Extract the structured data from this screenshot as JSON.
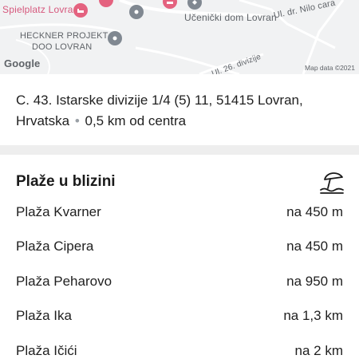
{
  "map": {
    "labels": {
      "spielplatz": "Spielplatz Lovran",
      "ucenicki": "Učenički dom Lovran",
      "street_nilo": "Ul. dr. Nilo cara",
      "heckner_line1": "HECKNER PROJEKT",
      "heckner_line2": "DOO LOVRAN",
      "street_26": "Ul. 26. divizije"
    },
    "logo": "Google",
    "attribution": "Map data ©2021"
  },
  "address": {
    "text": "C. 43. Istarske divizije 1/4 (5) 11, 51415 Lovran, Hrvatska",
    "separator": "•",
    "distance": "0,5 km od centra"
  },
  "beaches": {
    "title": "Plaže u blizini",
    "icon": "beach-umbrella-icon",
    "items": [
      {
        "name": "Plaža Kvarner",
        "distance": "na 450 m"
      },
      {
        "name": "Plaža Cipera",
        "distance": "na 450 m"
      },
      {
        "name": "Plaža Peharovo",
        "distance": "na 950 m"
      },
      {
        "name": "Plaža Ika",
        "distance": "na 1,3 km"
      },
      {
        "name": "Plaža Ičići",
        "distance": "na 2 km"
      }
    ]
  },
  "colors": {
    "map_background": "#f1f2f3",
    "poi_pink": "#e4627f",
    "poi_gray": "#808891",
    "separator": "#eeeeee"
  }
}
